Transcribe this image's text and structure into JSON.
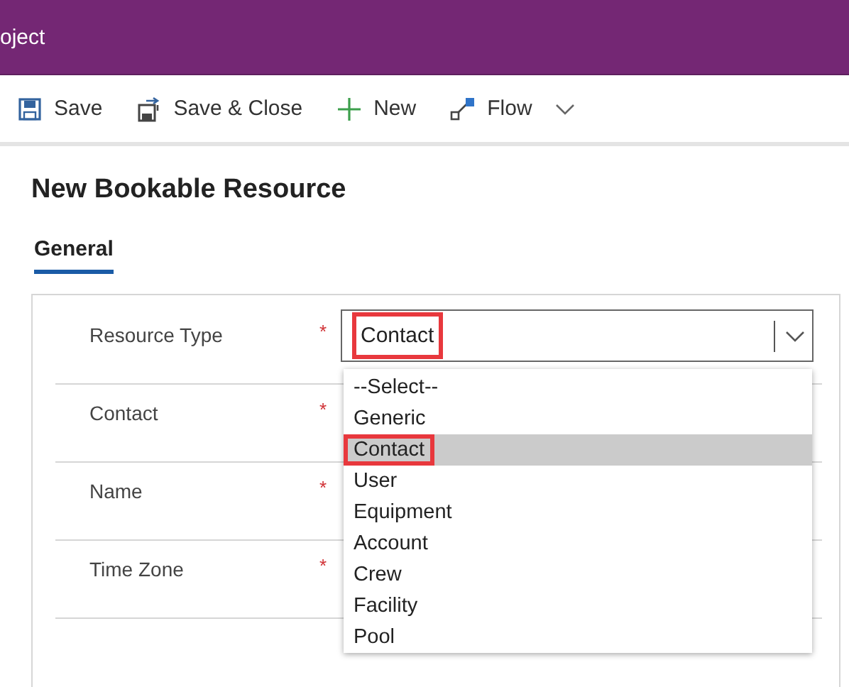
{
  "header": {
    "title": "oject"
  },
  "toolbar": [
    {
      "kind": "save",
      "label": "Save"
    },
    {
      "kind": "save-close",
      "label": "Save & Close"
    },
    {
      "kind": "new",
      "label": "New"
    },
    {
      "kind": "flow",
      "label": "Flow"
    }
  ],
  "form": {
    "title": "New Bookable Resource",
    "tabs": [
      {
        "label": "General",
        "selected": true
      }
    ],
    "fields": [
      {
        "label": "Resource Type",
        "required_mark": "*",
        "value": "Contact",
        "highlighted": true
      },
      {
        "label": "Contact",
        "required_mark": "*"
      },
      {
        "label": "Name",
        "required_mark": "*"
      },
      {
        "label": "Time Zone",
        "required_mark": "*"
      }
    ],
    "dropdown_options": [
      {
        "label": "--Select--",
        "selected": false,
        "highlighted": false
      },
      {
        "label": "Generic",
        "selected": false,
        "highlighted": false
      },
      {
        "label": "Contact",
        "selected": true,
        "highlighted": true
      },
      {
        "label": "User",
        "selected": false,
        "highlighted": false
      },
      {
        "label": "Equipment",
        "selected": false,
        "highlighted": false
      },
      {
        "label": "Account",
        "selected": false,
        "highlighted": false
      },
      {
        "label": "Crew",
        "selected": false,
        "highlighted": false
      },
      {
        "label": "Facility",
        "selected": false,
        "highlighted": false
      },
      {
        "label": "Pool",
        "selected": false,
        "highlighted": false
      }
    ]
  }
}
